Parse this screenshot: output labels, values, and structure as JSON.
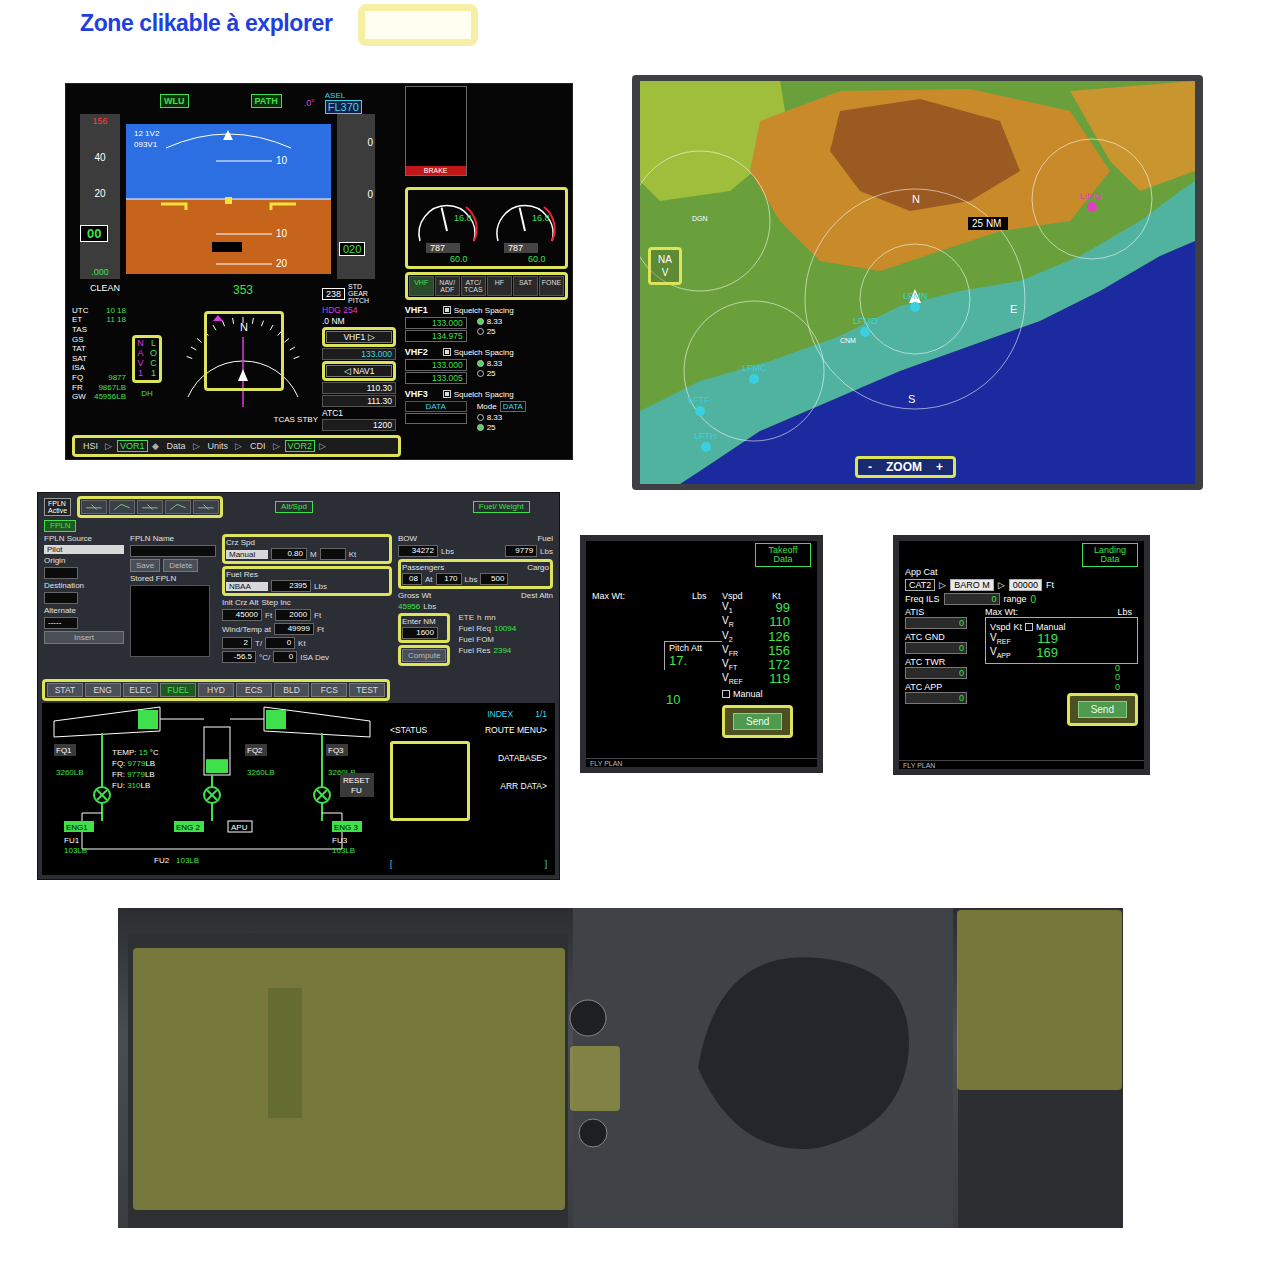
{
  "header": {
    "title": "Zone clikable à explorer"
  },
  "pfd": {
    "modes": [
      "WLU",
      "PATH"
    ],
    "pitch_readout": ".0°",
    "asel_label": "ASEL",
    "asel_value": "FL370",
    "speed_bug": "156",
    "speed_ticks": [
      "40",
      "20"
    ],
    "speed": "00",
    "speed_trend": ".000",
    "vspeed_labels": [
      "12 1V2",
      "093V1"
    ],
    "pitch_ticks": [
      "10",
      "10",
      "20"
    ],
    "alt_ticks": [
      "0",
      "0"
    ],
    "altitude": "020",
    "config": "CLEAN",
    "heading": "353",
    "course": "238",
    "std": "STD",
    "gear": "GEAR",
    "pitch_label": "PITCH",
    "hdg_label": "HDG",
    "hdg_value": "254",
    "distance": ".0 NM",
    "data_rows": [
      {
        "label": "UTC",
        "value": "10 18"
      },
      {
        "label": "ET",
        "value": "11 18"
      },
      {
        "label": "TAS"
      },
      {
        "label": "GS"
      },
      {
        "label": "TAT"
      },
      {
        "label": "SAT"
      },
      {
        "label": "ISA"
      },
      {
        "label": "FQ",
        "value": "9877"
      },
      {
        "label": "FR",
        "value": "9867LB"
      },
      {
        "label": "GW",
        "value": "45956LB"
      }
    ],
    "nav_source": "NAV1",
    "loc_source": "LOC1",
    "dh": "DH",
    "compass_label": "N",
    "tcas": "TCAS STBY",
    "radio_select": "VHF1 ▷",
    "radio_freq": "133.000",
    "nav_select": "◁ NAV1",
    "nav_active": "110.30",
    "nav_standby": "111.30",
    "atc_label": "ATC1",
    "atc_code": "1200",
    "softkeys": [
      {
        "label": "HSI",
        "arrow": "▷",
        "selected": false
      },
      {
        "label": "VOR1",
        "arrow": "◆",
        "selected": true
      },
      {
        "label": "Data",
        "arrow": "▷",
        "selected": false
      },
      {
        "label": "Units",
        "arrow": "▷",
        "selected": false
      },
      {
        "label": "CDI",
        "arrow": "▷",
        "selected": false
      },
      {
        "label": "VOR2",
        "arrow": "▷",
        "selected": true
      }
    ]
  },
  "engine_radio": {
    "brake": "BRAKE",
    "gauges": [
      {
        "n1": "16.8",
        "itt": "787",
        "oil": "60.0",
        "level": 0.45
      },
      {
        "n1": "16.8",
        "itt": "787",
        "oil": "60.0",
        "level": 0.45
      }
    ],
    "tabs": [
      {
        "label": "VHF",
        "selected": true
      },
      {
        "label": "NAV/ ADF",
        "selected": false
      },
      {
        "label": "ATC/ TCAS",
        "selected": false
      },
      {
        "label": "HF",
        "selected": false
      },
      {
        "label": "SAT",
        "selected": false
      },
      {
        "label": "FONE",
        "selected": false
      }
    ],
    "radios": [
      {
        "kind": "freq",
        "name": "VHF1",
        "squelch": "Squelch Spacing",
        "squelch_on": true,
        "active": "133.000",
        "standby": "134.975",
        "spacing": [
          {
            "label": "8.33",
            "selected": true
          },
          {
            "label": "25",
            "selected": false
          }
        ]
      },
      {
        "kind": "freq",
        "name": "VHF2",
        "squelch": "Squelch Spacing",
        "squelch_on": true,
        "active": "133.000",
        "standby": "133.005",
        "spacing": [
          {
            "label": "8.33",
            "selected": true
          },
          {
            "label": "25",
            "selected": false
          }
        ]
      },
      {
        "kind": "data",
        "name": "VHF3",
        "squelch": "Squelch Spacing",
        "squelch_on": true,
        "data_tag": "DATA",
        "mode_label": "Mode",
        "mode": "DATA",
        "spacing": [
          {
            "label": "8.33",
            "selected": false
          },
          {
            "label": "25",
            "selected": true
          }
        ]
      }
    ]
  },
  "map": {
    "nav_label": "NAV",
    "zoom_minus": "-",
    "zoom_label": "ZOOM",
    "zoom_plus": "+",
    "range": "25 NM",
    "compass": [
      "N",
      "E",
      "S"
    ],
    "airports": [
      {
        "id": "LIMG",
        "color": "#e040c0"
      },
      {
        "id": "LFMN",
        "color": "#3ad0e0"
      },
      {
        "id": "LFMD",
        "color": "#3ad0e0"
      },
      {
        "id": "LFMC",
        "color": "#3ad0e0"
      },
      {
        "id": "LFTF",
        "color": "#3ad0e0"
      },
      {
        "id": "LFTH",
        "color": "#3ad0e0"
      }
    ],
    "navaids": [
      "DGN",
      "CNM"
    ]
  },
  "fms": {
    "fpln_label": "FPLN",
    "fpln_state": "Active",
    "tabs": [
      {
        "label": "FPLN",
        "selected": true
      },
      {
        "label": "Alt/Spd",
        "selected": false
      },
      {
        "label": "Fuel/ Weight",
        "selected": false
      }
    ],
    "source_label": "FPLN Source",
    "source": "Pilot",
    "origin_label": "Origin",
    "destination_label": "Destination",
    "alternate_label": "Alternate",
    "alternate": "-----",
    "insert": "Insert",
    "name_label": "FPLN Name",
    "save": "Save",
    "delete": "Delete",
    "stored_label": "Stored FPLN",
    "crz_spd_label": "Crz Spd",
    "crz_mode": "Manual",
    "crz_mach": "0.80",
    "crz_mach_unit": "M",
    "kt": "Kt",
    "fuel_res_label": "Fuel Res",
    "fuel_res_mode": "NBAA",
    "fuel_res": "2395",
    "lbs": "Lbs",
    "init_alt_label": "Init Crz Alt",
    "init_alt": "45000",
    "step_label": "Step Inc",
    "step": "2000",
    "ft": "Ft",
    "wind_label": "Wind/Temp at",
    "wind_alt": "49999",
    "wind_dir": "2",
    "wind_t": "T/",
    "wind_kt": "0",
    "temp": "-56.5",
    "temp_unit": "°C/",
    "isa": "0",
    "isa_label": "ISA Dev",
    "bow_label": "BOW",
    "bow": "34272",
    "fuel_label": "Fuel",
    "fuel": "9779",
    "pax_label": "Passengers",
    "pax": "08",
    "pax_at": "At",
    "pax_weight": "170",
    "cargo_label": "Cargo",
    "cargo": "500",
    "gross_label": "Gross Wt",
    "gross": "45956",
    "dest_altn": "Dest Altn",
    "enter_nm_label": "Enter NM",
    "enter_nm": "1600",
    "compute": "Compute",
    "ete_label": "ETE",
    "ete_h": "h",
    "ete_mn": "mn",
    "fuel_req_label": "Fuel Req",
    "fuel_req": "10094",
    "fuel_fom_label": "Fuel FOM",
    "fuel_res2_label": "Fuel Res",
    "fuel_res2": "2394",
    "systems": [
      {
        "label": "STAT",
        "selected": false
      },
      {
        "label": "ENG",
        "selected": false
      },
      {
        "label": "ELEC",
        "selected": false
      },
      {
        "label": "FUEL",
        "selected": true
      },
      {
        "label": "HYD",
        "selected": false
      },
      {
        "label": "ECS",
        "selected": false
      },
      {
        "label": "BLD",
        "selected": false
      },
      {
        "label": "FCS",
        "selected": false
      },
      {
        "label": "TEST",
        "selected": false
      }
    ],
    "synoptic": {
      "tanks": [
        {
          "label": "FQ1",
          "value": "3260LB"
        },
        {
          "label": "FQ2",
          "value": "3260LB"
        },
        {
          "label": "FQ3",
          "value": "3260LB"
        }
      ],
      "temp_label": "TEMP:",
      "temp": "15",
      "temp_unit": "°C",
      "fq_label": "FQ:",
      "fq": "9779",
      "fr_label": "FR:",
      "fr": "9779",
      "fu_label": "FU:",
      "fu": "310",
      "lb": "LB",
      "reset": "RESET",
      "reset_sub": "FU",
      "apu": "APU",
      "center_level": 0.3,
      "engines": [
        {
          "label": "ENG1",
          "fu_label": "FU1",
          "fu": "103LB"
        },
        {
          "label": "ENG 2",
          "fu_label": "FU2",
          "fu": "103LB"
        },
        {
          "label": "ENG 3",
          "fu_label": "FU3",
          "fu": "103LB"
        }
      ]
    },
    "index": {
      "title": "INDEX",
      "page": "1/1",
      "left": "<STATUS",
      "right": [
        "ROUTE MENU>",
        "DATABASE>",
        "ARR DATA>"
      ],
      "open": "[",
      "close": "]"
    }
  },
  "takeoff": {
    "tab": "Takeoff Data",
    "max_wt": "Max Wt:",
    "lbs": "Lbs",
    "vspd": "Vspd",
    "kt": "Kt",
    "speeds": [
      {
        "label": "V",
        "sub": "1",
        "value": "99"
      },
      {
        "label": "V",
        "sub": "R",
        "value": "110"
      },
      {
        "label": "V",
        "sub": "2",
        "value": "126"
      },
      {
        "label": "V",
        "sub": "FR",
        "value": "156"
      },
      {
        "label": "V",
        "sub": "FT",
        "value": "172"
      },
      {
        "label": "V",
        "sub": "REF",
        "value": "119"
      }
    ],
    "pitch_label": "Pitch Att",
    "pitch": "17.",
    "manual": "Manual",
    "manual_checked": false,
    "flaps": "10",
    "send": "Send",
    "footer": "FLY PLAN"
  },
  "landing": {
    "tab": "Landing Data",
    "app_cat_label": "App Cat",
    "app_cat": "CAT2",
    "arrow": "▷",
    "baro": "BARO M",
    "mins": "00000",
    "ft": "Ft",
    "freq_label": "Freq ILS",
    "freq": "0",
    "range_label": "range",
    "range": "0",
    "comms": [
      {
        "label": "ATIS",
        "value": "0"
      },
      {
        "label": "ATC GND",
        "value": "0"
      },
      {
        "label": "ATC TWR",
        "value": "0"
      },
      {
        "label": "ATC APP",
        "value": "0"
      }
    ],
    "max_wt": "Max Wt:",
    "lbs": "Lbs",
    "vspd": "Vspd",
    "kt": "Kt",
    "manual": "Manual",
    "manual_checked": false,
    "speeds": [
      {
        "label": "V",
        "sub": "REF",
        "value": "119"
      },
      {
        "label": "V",
        "sub": "APP",
        "value": "169"
      }
    ],
    "extra_values": [
      "0",
      "0",
      "0"
    ],
    "send": "Send",
    "footer": "FLY PLAN"
  }
}
